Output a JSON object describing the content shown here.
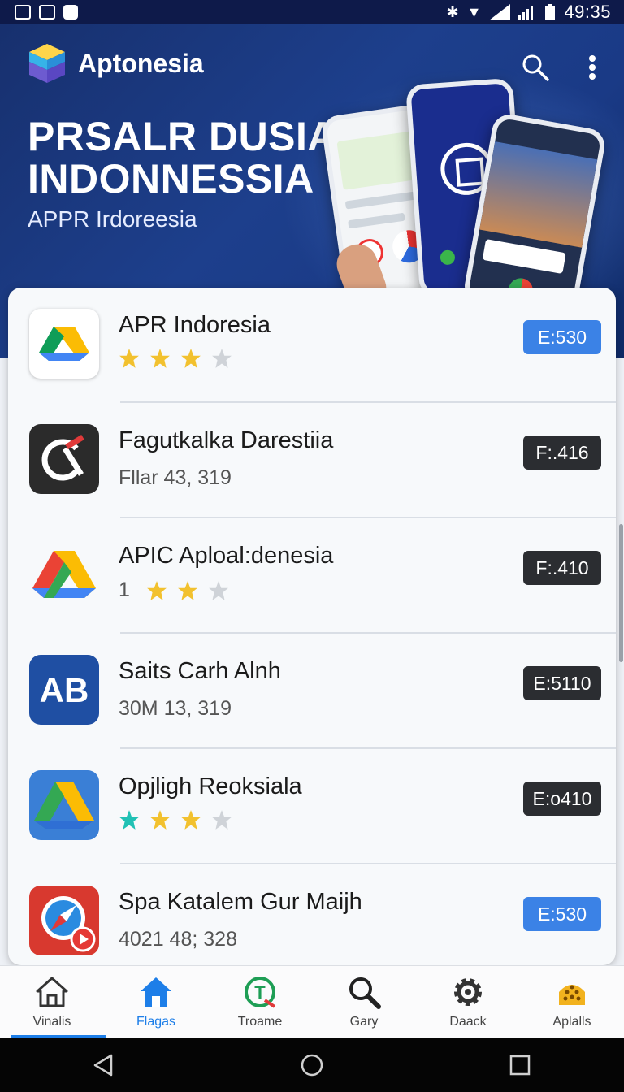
{
  "status_bar": {
    "time": "49:35"
  },
  "header": {
    "app_name": "Aptonesia",
    "hero_title": "PRSALR DUSIA INDONNESSIA",
    "hero_subtitle": "APPR Irdoreesia"
  },
  "apps": [
    {
      "title": "APR Indoresia",
      "rating_stars": 3,
      "rating_max": 4,
      "price": "E:530",
      "price_style": "blue",
      "icon": "google-drive-icon"
    },
    {
      "title": "Fagutkalka Darestiia",
      "subtitle": "Fllar 43, 319",
      "price": "F:.416",
      "price_style": "dark",
      "icon": "clock-app-icon"
    },
    {
      "title": "APIC Aploal:denesia",
      "rating_prefix": "1",
      "rating_stars": 2,
      "rating_max": 3,
      "price": "F:.410",
      "price_style": "dark",
      "icon": "google-drive-icon"
    },
    {
      "title": "Saits Carh Alnh",
      "subtitle": "30M 13, 319",
      "price": "E:5110",
      "price_style": "dark",
      "icon": "ab-app-icon"
    },
    {
      "title": "Opjligh Reoksiala",
      "rating_stars": 3,
      "rating_max": 4,
      "price": "E:o410",
      "price_style": "dark",
      "icon": "google-drive-icon"
    },
    {
      "title": "Spa Katalem Gur Maijh",
      "subtitle": "4021 48; 328",
      "price": "E:530",
      "price_style": "blue",
      "icon": "safari-compass-icon"
    }
  ],
  "bottom_nav": [
    {
      "label": "Vinalis",
      "icon": "home-outline-icon",
      "active": false
    },
    {
      "label": "Flagas",
      "icon": "home-filled-icon",
      "active": true
    },
    {
      "label": "Troame",
      "icon": "t-badge-icon",
      "active": false
    },
    {
      "label": "Gary",
      "icon": "search-icon",
      "active": false
    },
    {
      "label": "Daack",
      "icon": "gear-icon",
      "active": false
    },
    {
      "label": "Aplalls",
      "icon": "apps-grid-icon",
      "active": false
    }
  ],
  "colors": {
    "accent": "#1d7ee8",
    "header_bg": "#1d3f8c",
    "price_blue": "#3b82e6",
    "price_dark": "#2b2d31"
  }
}
